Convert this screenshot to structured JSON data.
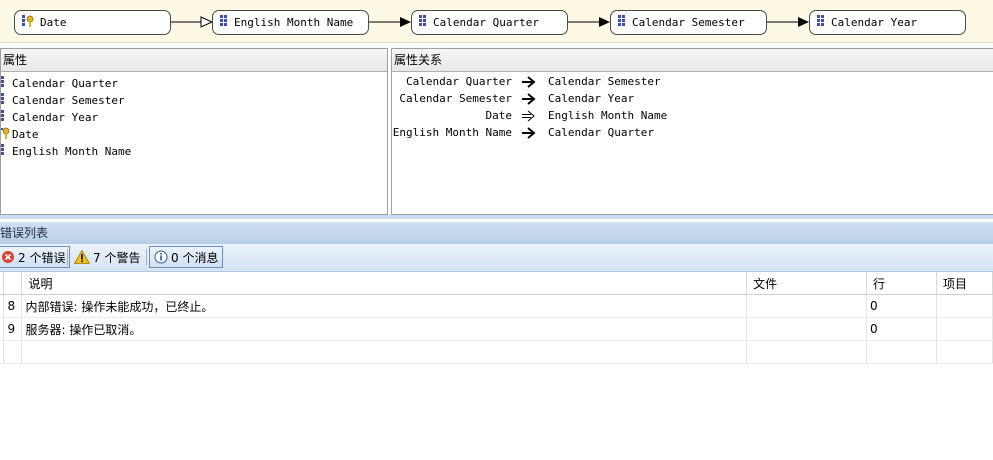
{
  "diagram": {
    "nodes": [
      {
        "label": "Date",
        "icon": "key-attribute-icon"
      },
      {
        "label": "English Month Name",
        "icon": "attribute-icon"
      },
      {
        "label": "Calendar Quarter",
        "icon": "attribute-icon"
      },
      {
        "label": "Calendar Semester",
        "icon": "attribute-icon"
      },
      {
        "label": "Calendar Year",
        "icon": "attribute-icon"
      }
    ]
  },
  "attributes_panel": {
    "title": "属性",
    "items": [
      {
        "label": "Calendar Quarter",
        "icon": "attribute-icon"
      },
      {
        "label": "Calendar Semester",
        "icon": "attribute-icon"
      },
      {
        "label": "Calendar Year",
        "icon": "attribute-icon"
      },
      {
        "label": "Date",
        "icon": "key-attribute-icon"
      },
      {
        "label": "English Month Name",
        "icon": "attribute-icon"
      }
    ]
  },
  "relationships_panel": {
    "title": "属性关系",
    "rows": [
      {
        "from": "Calendar Quarter",
        "to": "Calendar Semester",
        "arrow": "solid"
      },
      {
        "from": "Calendar Semester",
        "to": "Calendar Year",
        "arrow": "solid"
      },
      {
        "from": "Date",
        "to": "English Month Name",
        "arrow": "hollow"
      },
      {
        "from": "English Month Name",
        "to": "Calendar Quarter",
        "arrow": "solid"
      }
    ]
  },
  "error_list": {
    "title": "错误列表",
    "toolbar": {
      "errors": "2 个错误",
      "warnings": "7 个警告",
      "messages": "0 个消息"
    },
    "columns": {
      "description": "说明",
      "file": "文件",
      "line": "行",
      "project": "项目"
    },
    "rows": [
      {
        "index": "8",
        "description": "内部错误: 操作未能成功，已终止。",
        "file": "",
        "line": "0",
        "project": ""
      },
      {
        "index": "9",
        "description": "服务器: 操作已取消。",
        "file": "",
        "line": "0",
        "project": ""
      }
    ]
  },
  "colors": {
    "diagram_bg": "#fdf9e4",
    "header_blue": "#cfe0f2",
    "error_red": "#d9442e",
    "warning_yellow": "#f2c21a",
    "attribute_icon_blue": "#3b4fb0"
  }
}
